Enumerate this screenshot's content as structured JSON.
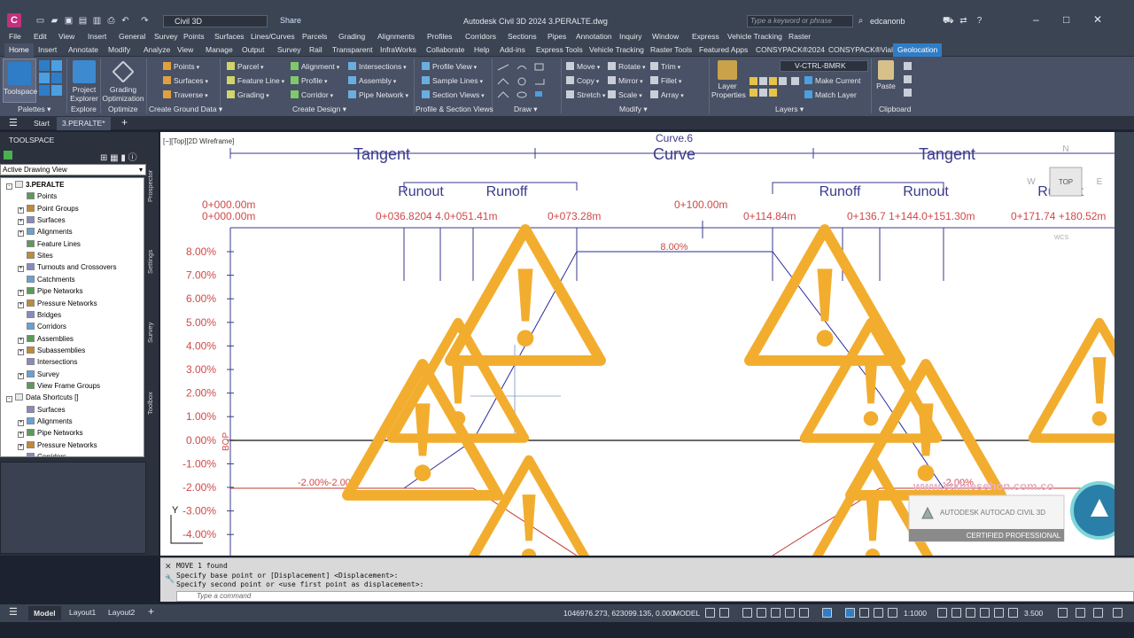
{
  "app": {
    "title": "Autodesk Civil 3D 2024    3.PERALTE.dwg",
    "workspace": "Civil 3D",
    "share": "Share",
    "search_placeholder": "Type a keyword or phrase",
    "user": "edcanonb",
    "logo_letter": "C"
  },
  "menus": [
    "File",
    "Edit",
    "View",
    "Insert",
    "General",
    "Survey",
    "Points",
    "Surfaces",
    "Lines/Curves",
    "Parcels",
    "Grading",
    "Alignments",
    "Profiles",
    "Corridors",
    "Sections",
    "Pipes",
    "Annotation",
    "Inquiry",
    "Window",
    "Express",
    "Vehicle Tracking",
    "Raster"
  ],
  "ribbon_tabs": [
    "Home",
    "Insert",
    "Annotate",
    "Modify",
    "Analyze",
    "View",
    "Manage",
    "Output",
    "Survey",
    "Rail",
    "Transparent",
    "InfraWorks",
    "Collaborate",
    "Help",
    "Add-ins",
    "Express Tools",
    "Vehicle Tracking",
    "Raster Tools",
    "Featured Apps",
    "CONSYPACK®2024",
    "CONSYPACK®Vial",
    "Geolocation"
  ],
  "ribbon": {
    "toolspace": "Toolspace",
    "project_explorer": "Project Explorer",
    "grading_optimization": "Grading Optimization",
    "panels": {
      "palettes": "Palettes",
      "explore": "Explore",
      "optimize": "Optimize",
      "create_ground_data": "Create Ground Data",
      "create_design": "Create Design",
      "profile_section_views": "Profile & Section Views",
      "draw": "Draw",
      "modify": "Modify",
      "layers": "Layers",
      "clipboard": "Clipboard"
    },
    "ground": [
      "Points",
      "Surfaces",
      "Traverse"
    ],
    "design_col1": [
      "Parcel",
      "Feature Line",
      "Grading"
    ],
    "design_col2": [
      "Alignment",
      "Profile",
      "Corridor"
    ],
    "design_col3": [
      "Intersections",
      "Assembly",
      "Pipe Network"
    ],
    "views": [
      "Profile View",
      "Sample Lines",
      "Section Views"
    ],
    "modify_col1": [
      "Move",
      "Copy",
      "Stretch"
    ],
    "modify_col2": [
      "Rotate",
      "Mirror",
      "Scale"
    ],
    "modify_col3": [
      "Trim",
      "Fillet",
      "Array"
    ],
    "layer_name": "V-CTRL-BMRK",
    "layer_properties": "Layer Properties",
    "make_current": "Make Current",
    "match_layer": "Match Layer",
    "paste": "Paste"
  },
  "file_tabs": {
    "start": "Start",
    "active": "3.PERALTE*"
  },
  "toolspace": {
    "title": "TOOLSPACE",
    "view": "Active Drawing View",
    "side_tabs": [
      "Prospector",
      "Settings",
      "Survey",
      "Toolbox"
    ],
    "tree": [
      {
        "label": "3.PERALTE",
        "level": 0,
        "bold": true,
        "ex": "-"
      },
      {
        "label": "Points",
        "level": 1,
        "ex": ""
      },
      {
        "label": "Point Groups",
        "level": 1,
        "ex": "+"
      },
      {
        "label": "Surfaces",
        "level": 1,
        "ex": "+"
      },
      {
        "label": "Alignments",
        "level": 1,
        "ex": "+"
      },
      {
        "label": "Feature Lines",
        "level": 1,
        "ex": ""
      },
      {
        "label": "Sites",
        "level": 1,
        "ex": ""
      },
      {
        "label": "Turnouts and Crossovers",
        "level": 1,
        "ex": "+"
      },
      {
        "label": "Catchments",
        "level": 1,
        "ex": ""
      },
      {
        "label": "Pipe Networks",
        "level": 1,
        "ex": "+"
      },
      {
        "label": "Pressure Networks",
        "level": 1,
        "ex": "+"
      },
      {
        "label": "Bridges",
        "level": 1,
        "ex": ""
      },
      {
        "label": "Corridors",
        "level": 1,
        "ex": ""
      },
      {
        "label": "Assemblies",
        "level": 1,
        "ex": "+"
      },
      {
        "label": "Subassemblies",
        "level": 1,
        "ex": "+"
      },
      {
        "label": "Intersections",
        "level": 1,
        "ex": ""
      },
      {
        "label": "Survey",
        "level": 1,
        "ex": "+"
      },
      {
        "label": "View Frame Groups",
        "level": 1,
        "ex": ""
      },
      {
        "label": "Data Shortcuts []",
        "level": 0,
        "ex": "-"
      },
      {
        "label": "Surfaces",
        "level": 1,
        "ex": ""
      },
      {
        "label": "Alignments",
        "level": 1,
        "ex": "+"
      },
      {
        "label": "Pipe Networks",
        "level": 1,
        "ex": "+"
      },
      {
        "label": "Pressure Networks",
        "level": 1,
        "ex": "+"
      },
      {
        "label": "Corridors",
        "level": 1,
        "ex": ""
      }
    ]
  },
  "drawing": {
    "view_label": "[−][Top][2D Wireframe]",
    "curve_name": "Curve.6",
    "segments": [
      "Tangent",
      "Curve",
      "Tangent"
    ],
    "runout_left": "Runout",
    "runoff_left": "Runoff",
    "runoff_right": "Runoff",
    "runout_right": "Runout",
    "runout_far": "Runout",
    "stations": [
      "0+000.00m",
      "0+000.00m",
      "0+036.8204 4.0+051.41m",
      "0+073.28m",
      "0+100.00m",
      "0+114.84m",
      "0+136.7 1+144.0+151.30m",
      "0+171.74 +180.52m"
    ],
    "slope_max": "8.00%",
    "slope_labels": "-2.00%-2.00%",
    "slope_right": "-2.00%",
    "y_ticks": [
      "8.00%",
      "7.00%",
      "6.00%",
      "5.00%",
      "4.00%",
      "3.00%",
      "2.00%",
      "1.00%",
      "0.00%",
      "-1.00%",
      "-2.00%",
      "-3.00%",
      "-4.00%"
    ],
    "bop": "BOP",
    "y_axis": "Y",
    "viewcube": {
      "top": "TOP",
      "n": "N",
      "w": "W",
      "e": "E",
      "wcs": "WCS"
    },
    "watermark_url": "www.etkinesehon.com.co",
    "cert_line1": "AUTODESK AUTOCAD CIVIL 3D",
    "cert_line2": "CERTIFIED PROFESSIONAL",
    "colors": {
      "warning": "#f2ad2e",
      "grid": "#3a3a8c",
      "slope": "#c0392b",
      "label": "#d04848"
    }
  },
  "command": {
    "lines": [
      "MOVE 1 found",
      "Specify base point or [Displacement] <Displacement>:",
      "Specify second point or <use first point as displacement>:"
    ],
    "placeholder": "Type a command"
  },
  "status": {
    "tabs": [
      "Model",
      "Layout1",
      "Layout2"
    ],
    "coords": "1046976.273, 623099.135, 0.000",
    "model": "MODEL",
    "scale": "1:1000",
    "lineweight": "3.500"
  }
}
